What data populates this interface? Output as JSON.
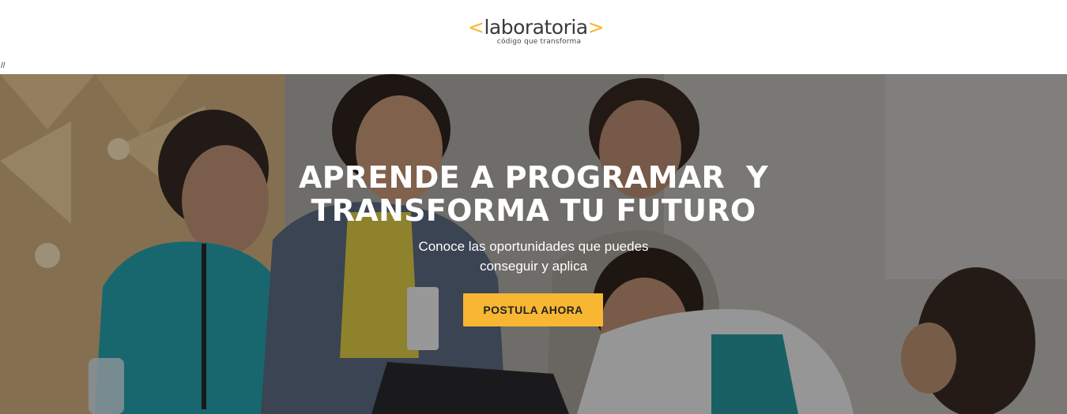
{
  "header": {
    "logo": {
      "bracket_left": "<",
      "wordmark": "laboratoria",
      "bracket_right": ">",
      "tagline": "código que transforma",
      "accent_color": "#f7b733"
    }
  },
  "stray_text": "//",
  "hero": {
    "title_line1": "APRENDE A PROGRAMAR  Y",
    "title_line2": "TRANSFORMA TU FUTURO",
    "subtitle_line1": "Conoce las oportunidades que puedes",
    "subtitle_line2": "conseguir y aplica",
    "cta_label": "POSTULA AHORA",
    "cta_color": "#f7b733",
    "background_image": "photo of women laughing and working together at laptops"
  }
}
